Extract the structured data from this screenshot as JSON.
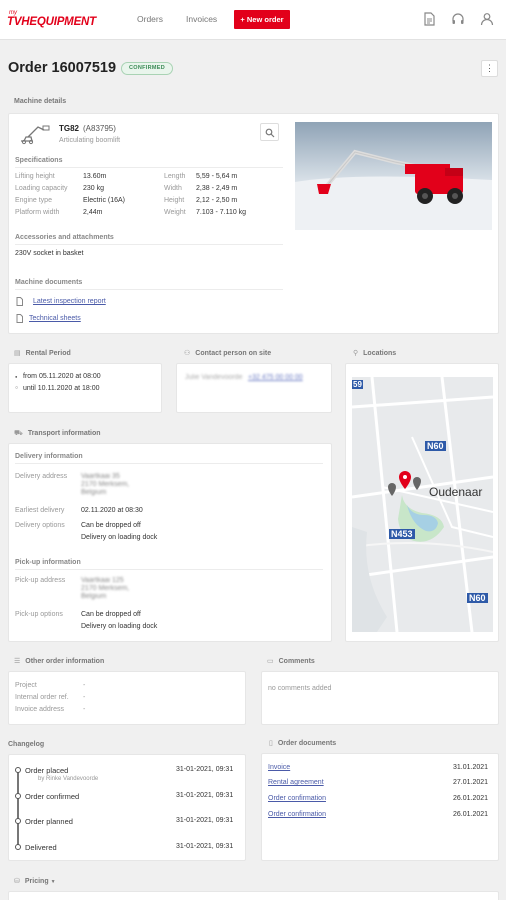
{
  "brand": {
    "prefix": "my",
    "name": "TVHEQUIPMENT",
    "color": "#e2001a"
  },
  "nav": {
    "orders": "Orders",
    "invoices": "Invoices",
    "new_order": "+ New order"
  },
  "header_icons": [
    "document-icon",
    "headset-icon",
    "user-icon"
  ],
  "order": {
    "title": "Order 16007519",
    "status": "CONFIRMED",
    "more": "⋮"
  },
  "machine": {
    "section": "Machine details",
    "model": "TG82",
    "code": "(A83795)",
    "type": "Articulating boomlift",
    "spec_title": "Specifications",
    "specs_left": [
      {
        "label": "Lifting height",
        "value": "13.60m"
      },
      {
        "label": "Loading capacity",
        "value": "230 kg"
      },
      {
        "label": "Engine type",
        "value": "Electric (16A)"
      },
      {
        "label": "Platform width",
        "value": "2,44m"
      }
    ],
    "specs_right": [
      {
        "label": "Length",
        "value": "5,59 - 5,64 m"
      },
      {
        "label": "Width",
        "value": "2,38 - 2,49 m"
      },
      {
        "label": "Height",
        "value": "2,12 - 2,50 m"
      },
      {
        "label": "Weight",
        "value": "7.103 - 7.110 kg"
      }
    ],
    "acc_title": "Accessories and attachments",
    "accessory": "230V socket in basket",
    "docs_title": "Machine documents",
    "docs": [
      "Latest inspection report",
      "Technical sheets"
    ]
  },
  "rental": {
    "section": "Rental Period",
    "from": "from 05.11.2020 at 08:00",
    "until": "until 10.11.2020 at 18:00"
  },
  "contact": {
    "section": "Contact person on site",
    "name": "Julie Vandevoorde",
    "phone": "+32 475 00 00 00"
  },
  "locations": {
    "section": "Locations",
    "roads": [
      "59",
      "N60",
      "N453",
      "N60"
    ],
    "town": "Oudenaar"
  },
  "transport": {
    "section": "Transport information",
    "delivery_title": "Delivery information",
    "delivery_address_label": "Delivery address",
    "delivery_address": [
      "Vaartkaai 35",
      "2170 Merksem,",
      "Belgium"
    ],
    "earliest_label": "Earliest delivery",
    "earliest": "02.11.2020 at 08:30",
    "delivery_options_label": "Delivery options",
    "delivery_options": [
      "Can be dropped off",
      "Delivery on loading dock"
    ],
    "pickup_title": "Pick-up information",
    "pickup_address_label": "Pick-up address",
    "pickup_address": [
      "Vaartkaai 125",
      "2170 Merksem,",
      "Belgium"
    ],
    "pickup_options_label": "Pick-up options",
    "pickup_options": [
      "Can be dropped off",
      "Delivery on loading dock"
    ]
  },
  "other": {
    "section": "Other order information",
    "rows": [
      {
        "label": "Project",
        "value": "-"
      },
      {
        "label": "Internal order ref.",
        "value": "-"
      },
      {
        "label": "Invoice address",
        "value": "-"
      }
    ]
  },
  "comments": {
    "section": "Comments",
    "empty": "no comments added"
  },
  "changelog": {
    "section": "Changelog",
    "items": [
      {
        "title": "Order placed",
        "by": "by Rinke Vandevoorde",
        "date": "31-01-2021, 09:31"
      },
      {
        "title": "Order confirmed",
        "by": "",
        "date": "31-01-2021, 09:31"
      },
      {
        "title": "Order planned",
        "by": "",
        "date": "31-01-2021, 09:31"
      },
      {
        "title": "Delivered",
        "by": "",
        "date": "31-01-2021, 09:31"
      }
    ]
  },
  "documents": {
    "section": "Order documents",
    "items": [
      {
        "name": "Invoice",
        "date": "31.01.2021"
      },
      {
        "name": "Rental agreement",
        "date": "27.01.2021"
      },
      {
        "name": "Order confirmation",
        "date": "26.01.2021"
      },
      {
        "name": "Order confirmation",
        "date": "26.01.2021"
      }
    ]
  },
  "pricing": {
    "section": "Pricing"
  }
}
